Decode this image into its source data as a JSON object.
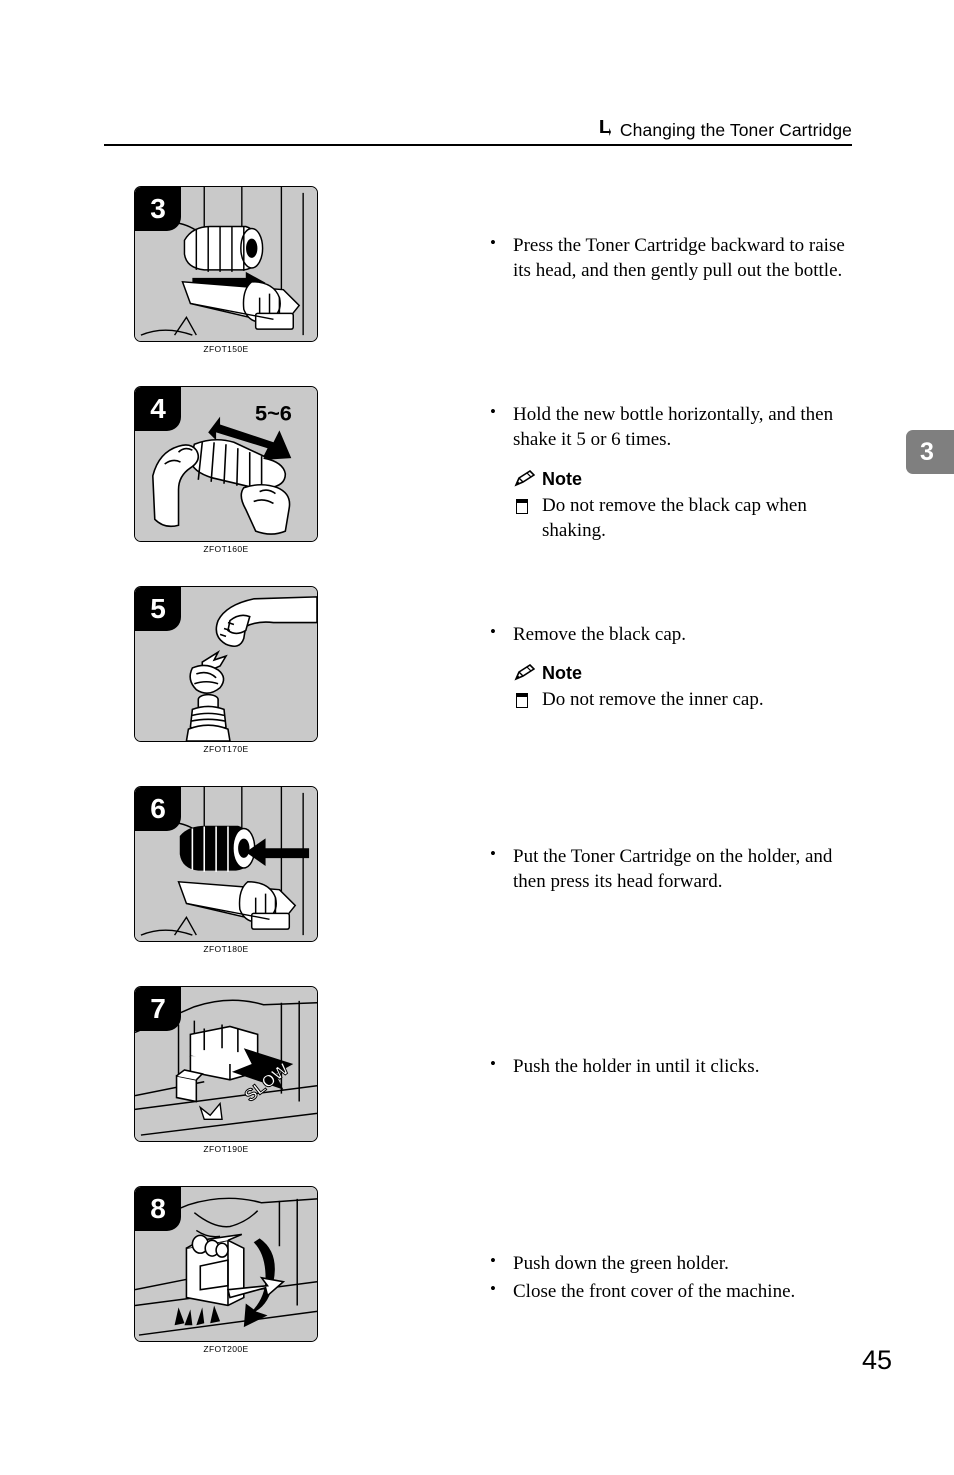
{
  "header": {
    "icon": "corner-arrow-icon",
    "title": "Changing the Toner Cartridge"
  },
  "chapter_tab": {
    "number": "3",
    "color": "#7f7f7f"
  },
  "page_number": "45",
  "note_label": "Note",
  "steps": [
    {
      "number": "3",
      "figure_code": "ZFOT150E",
      "figure_caption_text": "",
      "bullets": [
        "Press the Toner Cartridge backward to raise its head, and then gently pull out the bottle."
      ],
      "note": null
    },
    {
      "number": "4",
      "figure_code": "ZFOT160E",
      "figure_caption_text": "5~6",
      "bullets": [
        "Hold the new bottle horizontally, and then shake it 5 or 6 times."
      ],
      "note": {
        "label": "Note",
        "items": [
          "Do not remove the black cap when shaking."
        ]
      }
    },
    {
      "number": "5",
      "figure_code": "ZFOT170E",
      "figure_caption_text": "",
      "bullets": [
        "Remove the black cap."
      ],
      "note": {
        "label": "Note",
        "items": [
          "Do not remove the inner cap."
        ]
      }
    },
    {
      "number": "6",
      "figure_code": "ZFOT180E",
      "figure_caption_text": "",
      "bullets": [
        "Put the Toner Cartridge on the holder, and then press its head forward."
      ],
      "note": null
    },
    {
      "number": "7",
      "figure_code": "ZFOT190E",
      "figure_caption_text": "SLOW",
      "bullets": [
        "Push the holder in until it clicks."
      ],
      "note": null
    },
    {
      "number": "8",
      "figure_code": "ZFOT200E",
      "figure_caption_text": "",
      "bullets": [
        "Push down the green holder.",
        "Close the front cover of the machine."
      ],
      "note": null
    }
  ]
}
